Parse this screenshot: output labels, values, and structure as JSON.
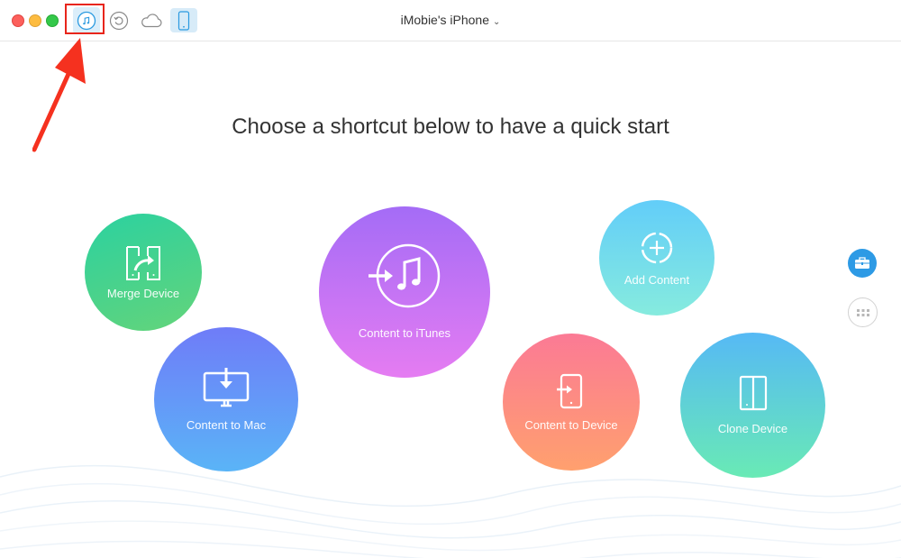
{
  "window": {
    "device_title": "iMobie's iPhone",
    "toolbar_icons": [
      "music-icon",
      "restore-icon",
      "cloud-icon",
      "phone-icon"
    ]
  },
  "main": {
    "headline": "Choose a shortcut below to have a quick start",
    "shortcuts": [
      {
        "label": "Merge Device",
        "icon": "merge-icon"
      },
      {
        "label": "Content to Mac",
        "icon": "mac-icon"
      },
      {
        "label": "Content to iTunes",
        "icon": "itunes-icon"
      },
      {
        "label": "Add Content",
        "icon": "add-icon"
      },
      {
        "label": "Content to Device",
        "icon": "device-import-icon"
      },
      {
        "label": "Clone Device",
        "icon": "clone-icon"
      }
    ]
  },
  "sidebar": {
    "buttons": [
      "toolbox-icon",
      "grid-icon"
    ]
  },
  "colors": {
    "accent": "#2d9ae5",
    "highlight": "#e8251b"
  }
}
